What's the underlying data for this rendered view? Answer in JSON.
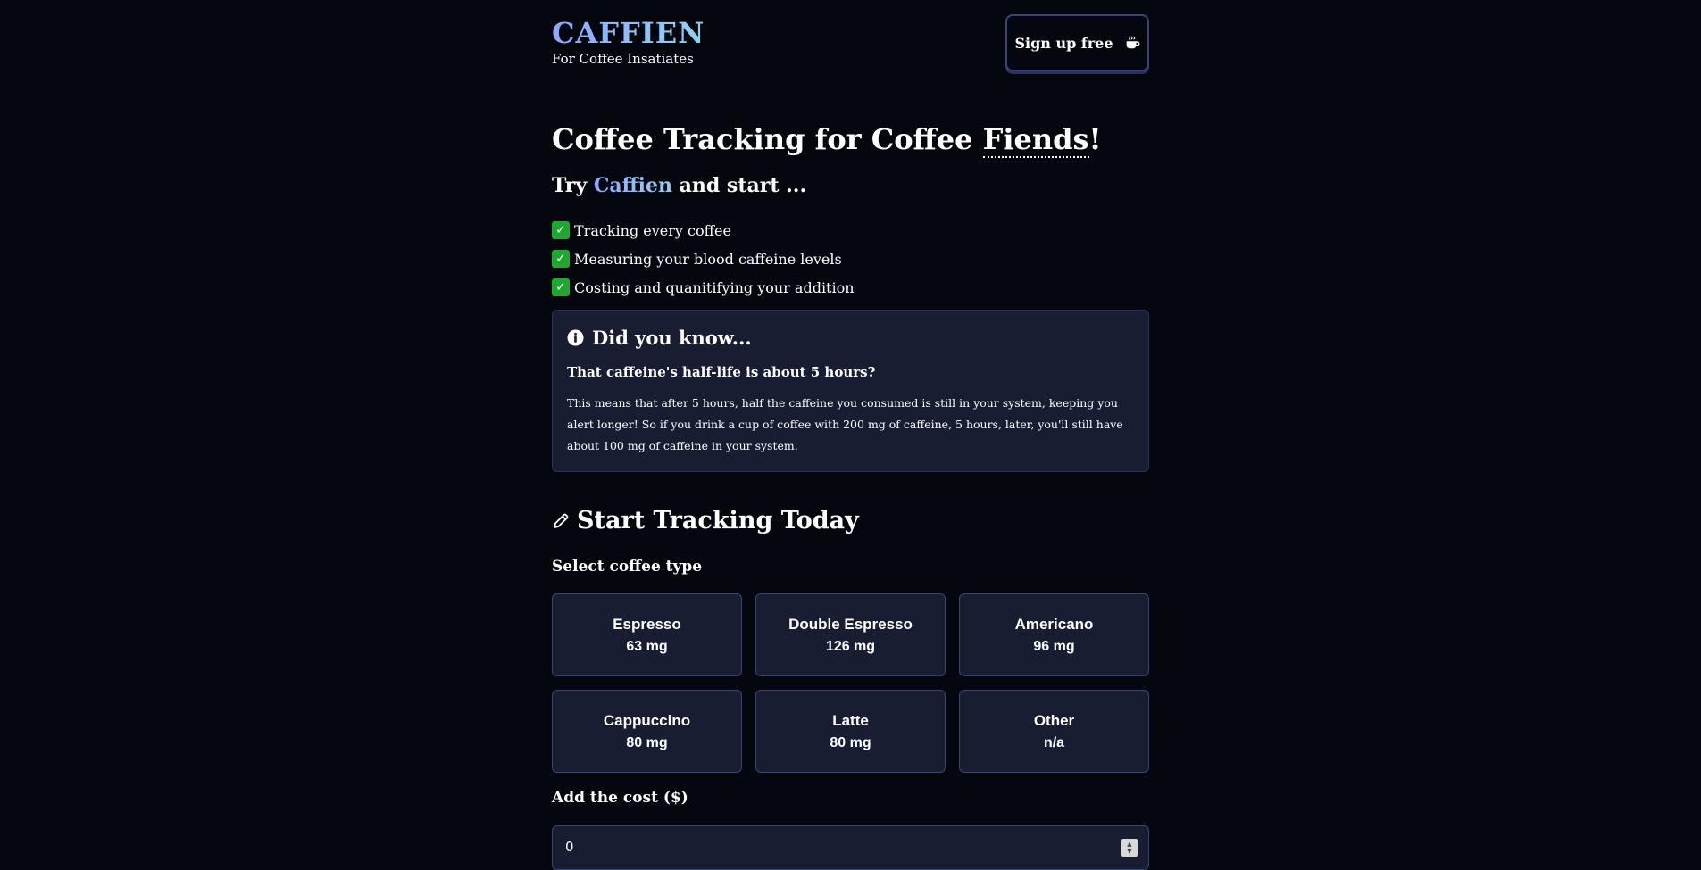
{
  "header": {
    "logo": "CAFFIEN",
    "tagline": "For Coffee Insatiates",
    "signup_label": "Sign up free",
    "signup_icon": "mug-hot-icon"
  },
  "hero": {
    "title_prefix": "Coffee Tracking for Coffee ",
    "title_emphasis": "Fiends",
    "title_suffix": "!",
    "try_prefix": "Try ",
    "try_brand": "Caffien",
    "try_suffix": " and start ...",
    "features": [
      "Tracking every coffee",
      "Measuring your blood caffeine levels",
      "Costing and quanitifying your addition"
    ]
  },
  "info": {
    "title": "Did you know...",
    "question": "That caffeine's half-life is about 5 hours?",
    "body": "This means that after 5 hours, half the caffeine you consumed is still in your system, keeping you alert longer! So if you drink a cup of coffee with 200 mg of caffeine, 5 hours, later, you'll still have about 100 mg of caffeine in your system."
  },
  "tracking": {
    "title": "Start Tracking Today",
    "select_label": "Select coffee type",
    "coffees": [
      {
        "name": "Espresso",
        "caffeine": "63 mg"
      },
      {
        "name": "Double Espresso",
        "caffeine": "126 mg"
      },
      {
        "name": "Americano",
        "caffeine": "96 mg"
      },
      {
        "name": "Cappuccino",
        "caffeine": "80 mg"
      },
      {
        "name": "Latte",
        "caffeine": "80 mg"
      },
      {
        "name": "Other",
        "caffeine": "n/a"
      }
    ],
    "cost_label": "Add the cost ($)",
    "cost_value": "0"
  },
  "colors": {
    "background": "#05070f",
    "card": "#181d32",
    "border": "#3a4477",
    "brand_gradient_start": "#8fa6ff",
    "brand_gradient_end": "#8fd3f0",
    "check_green": "#1fa82f"
  }
}
